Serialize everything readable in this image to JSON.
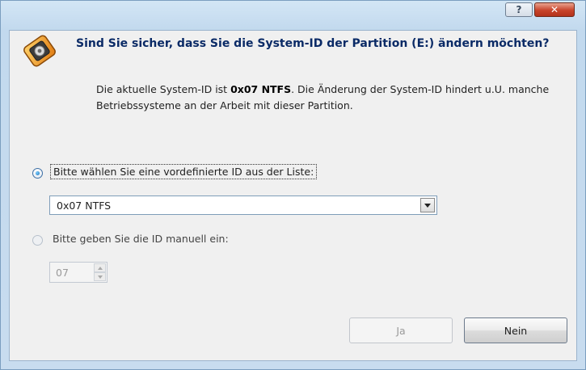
{
  "window": {
    "help_button": "?",
    "close_button": "✕"
  },
  "dialog": {
    "question": "Sind Sie sicher, dass Sie die System-ID der Partition (E:) ändern möchten?",
    "info_prefix": "Die aktuelle System-ID ist ",
    "info_current_id": "0x07 NTFS",
    "info_suffix": ". Die Änderung der System-ID hindert u.U. manche Betriebssysteme an der Arbeit mit dieser Partition.",
    "icon": "disk-warning-icon"
  },
  "option_list": {
    "label": "Bitte wählen Sie eine vordefinierte ID aus der Liste:",
    "selected": true,
    "combo_value": "0x07 NTFS"
  },
  "option_manual": {
    "label": "Bitte geben Sie die ID manuell ein:",
    "selected": false,
    "spin_value": "07"
  },
  "buttons": {
    "yes": "Ja",
    "no": "Nein"
  }
}
